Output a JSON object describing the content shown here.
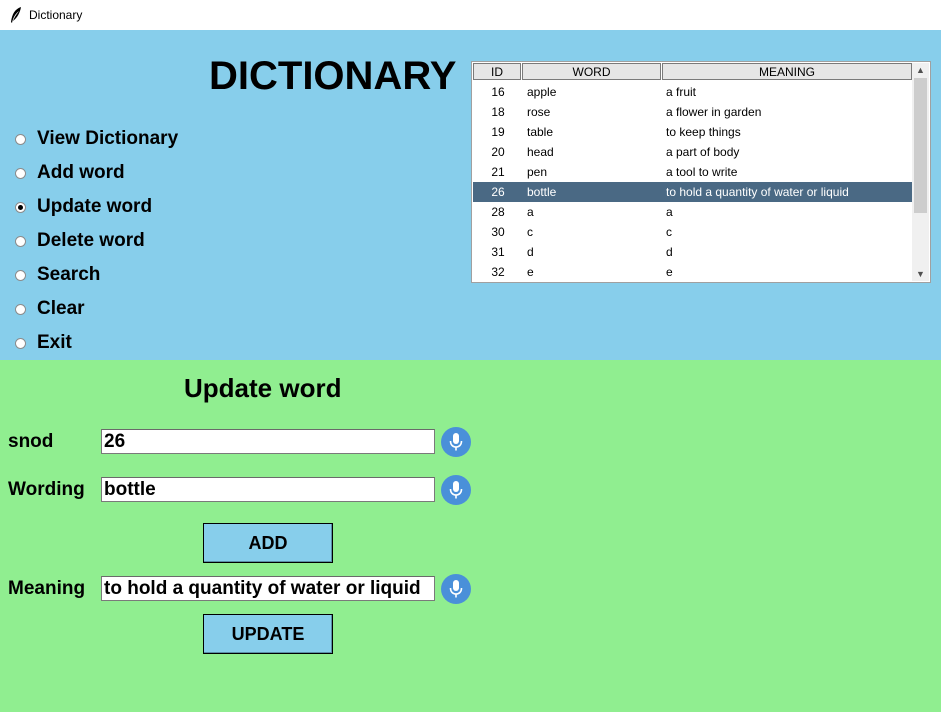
{
  "window": {
    "title": "Dictionary",
    "icon": "feather-icon"
  },
  "heading": "DICTIONARY",
  "menu": {
    "selected_index": 2,
    "items": [
      {
        "label": "View Dictionary"
      },
      {
        "label": "Add word"
      },
      {
        "label": "Update word"
      },
      {
        "label": "Delete word"
      },
      {
        "label": "Search"
      },
      {
        "label": "Clear"
      },
      {
        "label": "Exit"
      }
    ]
  },
  "table": {
    "columns": [
      "ID",
      "WORD",
      "MEANING"
    ],
    "selected_id": "26",
    "rows": [
      {
        "id": "16",
        "word": "apple",
        "meaning": "a fruit"
      },
      {
        "id": "18",
        "word": "rose",
        "meaning": "a flower in garden"
      },
      {
        "id": "19",
        "word": "table",
        "meaning": "to keep things"
      },
      {
        "id": "20",
        "word": "head",
        "meaning": "a part of body"
      },
      {
        "id": "21",
        "word": "pen",
        "meaning": "a tool to write"
      },
      {
        "id": "26",
        "word": "bottle",
        "meaning": "to hold a quantity of water or liquid"
      },
      {
        "id": "28",
        "word": "a",
        "meaning": "a"
      },
      {
        "id": "30",
        "word": "c",
        "meaning": "c"
      },
      {
        "id": "31",
        "word": "d",
        "meaning": "d"
      },
      {
        "id": "32",
        "word": "e",
        "meaning": "e"
      }
    ]
  },
  "form": {
    "title": "Update word",
    "snod_label": "snod",
    "snod_value": "26",
    "wording_label": "Wording",
    "wording_value": "bottle",
    "add_button": "ADD",
    "meaning_label": "Meaning",
    "meaning_value": "to hold a quantity of water or liquid",
    "update_button": "UPDATE"
  },
  "colors": {
    "top_panel": "#87ceeb",
    "bottom_panel": "#90ee90",
    "selection": "#4a6984",
    "mic": "#4a90d9"
  }
}
